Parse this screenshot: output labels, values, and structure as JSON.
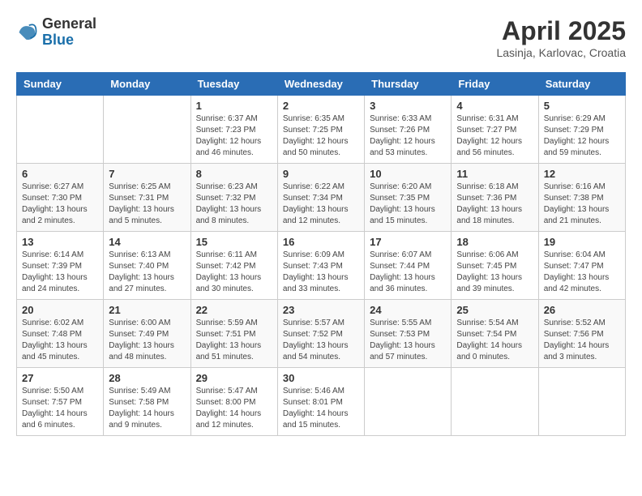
{
  "header": {
    "logo_line1": "General",
    "logo_line2": "Blue",
    "title": "April 2025",
    "subtitle": "Lasinja, Karlovac, Croatia"
  },
  "days_of_week": [
    "Sunday",
    "Monday",
    "Tuesday",
    "Wednesday",
    "Thursday",
    "Friday",
    "Saturday"
  ],
  "weeks": [
    [
      {
        "day": "",
        "info": ""
      },
      {
        "day": "",
        "info": ""
      },
      {
        "day": "1",
        "info": "Sunrise: 6:37 AM\nSunset: 7:23 PM\nDaylight: 12 hours\nand 46 minutes."
      },
      {
        "day": "2",
        "info": "Sunrise: 6:35 AM\nSunset: 7:25 PM\nDaylight: 12 hours\nand 50 minutes."
      },
      {
        "day": "3",
        "info": "Sunrise: 6:33 AM\nSunset: 7:26 PM\nDaylight: 12 hours\nand 53 minutes."
      },
      {
        "day": "4",
        "info": "Sunrise: 6:31 AM\nSunset: 7:27 PM\nDaylight: 12 hours\nand 56 minutes."
      },
      {
        "day": "5",
        "info": "Sunrise: 6:29 AM\nSunset: 7:29 PM\nDaylight: 12 hours\nand 59 minutes."
      }
    ],
    [
      {
        "day": "6",
        "info": "Sunrise: 6:27 AM\nSunset: 7:30 PM\nDaylight: 13 hours\nand 2 minutes."
      },
      {
        "day": "7",
        "info": "Sunrise: 6:25 AM\nSunset: 7:31 PM\nDaylight: 13 hours\nand 5 minutes."
      },
      {
        "day": "8",
        "info": "Sunrise: 6:23 AM\nSunset: 7:32 PM\nDaylight: 13 hours\nand 8 minutes."
      },
      {
        "day": "9",
        "info": "Sunrise: 6:22 AM\nSunset: 7:34 PM\nDaylight: 13 hours\nand 12 minutes."
      },
      {
        "day": "10",
        "info": "Sunrise: 6:20 AM\nSunset: 7:35 PM\nDaylight: 13 hours\nand 15 minutes."
      },
      {
        "day": "11",
        "info": "Sunrise: 6:18 AM\nSunset: 7:36 PM\nDaylight: 13 hours\nand 18 minutes."
      },
      {
        "day": "12",
        "info": "Sunrise: 6:16 AM\nSunset: 7:38 PM\nDaylight: 13 hours\nand 21 minutes."
      }
    ],
    [
      {
        "day": "13",
        "info": "Sunrise: 6:14 AM\nSunset: 7:39 PM\nDaylight: 13 hours\nand 24 minutes."
      },
      {
        "day": "14",
        "info": "Sunrise: 6:13 AM\nSunset: 7:40 PM\nDaylight: 13 hours\nand 27 minutes."
      },
      {
        "day": "15",
        "info": "Sunrise: 6:11 AM\nSunset: 7:42 PM\nDaylight: 13 hours\nand 30 minutes."
      },
      {
        "day": "16",
        "info": "Sunrise: 6:09 AM\nSunset: 7:43 PM\nDaylight: 13 hours\nand 33 minutes."
      },
      {
        "day": "17",
        "info": "Sunrise: 6:07 AM\nSunset: 7:44 PM\nDaylight: 13 hours\nand 36 minutes."
      },
      {
        "day": "18",
        "info": "Sunrise: 6:06 AM\nSunset: 7:45 PM\nDaylight: 13 hours\nand 39 minutes."
      },
      {
        "day": "19",
        "info": "Sunrise: 6:04 AM\nSunset: 7:47 PM\nDaylight: 13 hours\nand 42 minutes."
      }
    ],
    [
      {
        "day": "20",
        "info": "Sunrise: 6:02 AM\nSunset: 7:48 PM\nDaylight: 13 hours\nand 45 minutes."
      },
      {
        "day": "21",
        "info": "Sunrise: 6:00 AM\nSunset: 7:49 PM\nDaylight: 13 hours\nand 48 minutes."
      },
      {
        "day": "22",
        "info": "Sunrise: 5:59 AM\nSunset: 7:51 PM\nDaylight: 13 hours\nand 51 minutes."
      },
      {
        "day": "23",
        "info": "Sunrise: 5:57 AM\nSunset: 7:52 PM\nDaylight: 13 hours\nand 54 minutes."
      },
      {
        "day": "24",
        "info": "Sunrise: 5:55 AM\nSunset: 7:53 PM\nDaylight: 13 hours\nand 57 minutes."
      },
      {
        "day": "25",
        "info": "Sunrise: 5:54 AM\nSunset: 7:54 PM\nDaylight: 14 hours\nand 0 minutes."
      },
      {
        "day": "26",
        "info": "Sunrise: 5:52 AM\nSunset: 7:56 PM\nDaylight: 14 hours\nand 3 minutes."
      }
    ],
    [
      {
        "day": "27",
        "info": "Sunrise: 5:50 AM\nSunset: 7:57 PM\nDaylight: 14 hours\nand 6 minutes."
      },
      {
        "day": "28",
        "info": "Sunrise: 5:49 AM\nSunset: 7:58 PM\nDaylight: 14 hours\nand 9 minutes."
      },
      {
        "day": "29",
        "info": "Sunrise: 5:47 AM\nSunset: 8:00 PM\nDaylight: 14 hours\nand 12 minutes."
      },
      {
        "day": "30",
        "info": "Sunrise: 5:46 AM\nSunset: 8:01 PM\nDaylight: 14 hours\nand 15 minutes."
      },
      {
        "day": "",
        "info": ""
      },
      {
        "day": "",
        "info": ""
      },
      {
        "day": "",
        "info": ""
      }
    ]
  ]
}
